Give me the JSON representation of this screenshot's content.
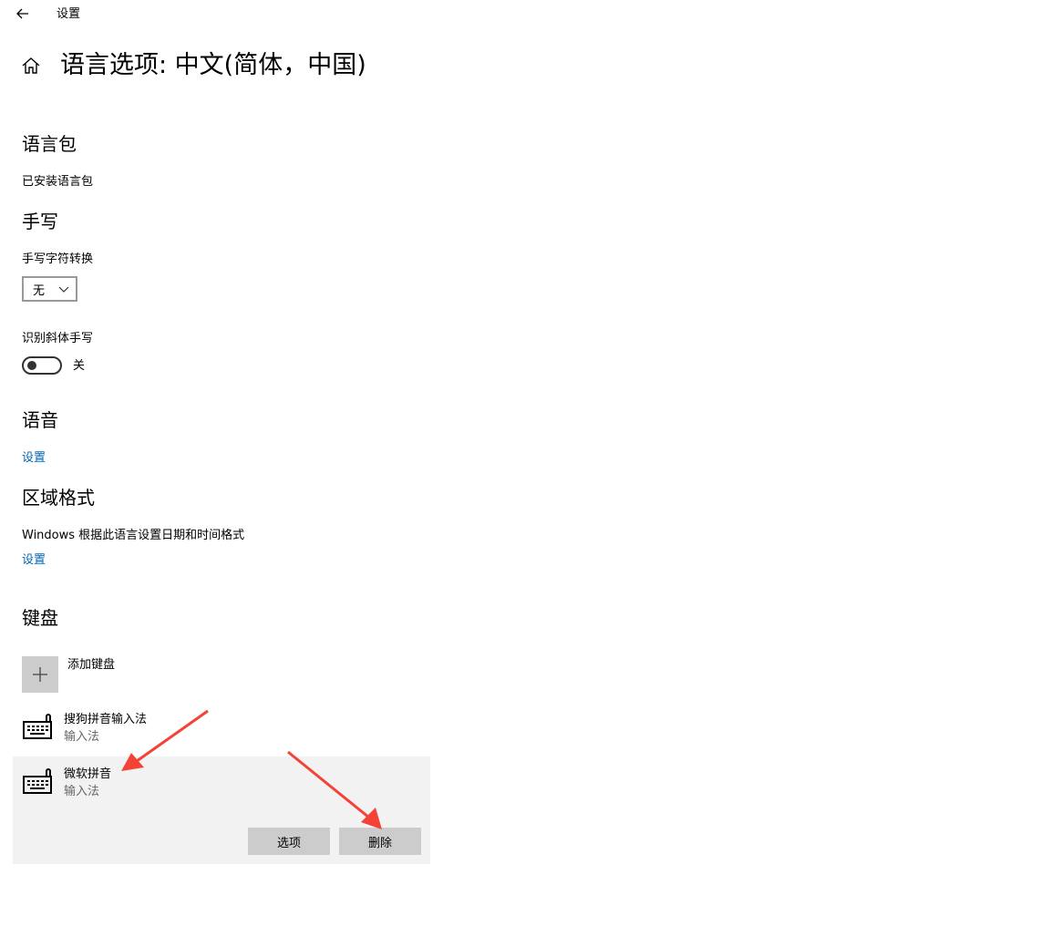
{
  "topbar": {
    "back_icon": "back-arrow-icon",
    "title": "设置"
  },
  "header": {
    "home_icon": "home-icon",
    "title": "语言选项: 中文(简体，中国)"
  },
  "language_pack": {
    "heading": "语言包",
    "status": "已安装语言包"
  },
  "handwriting": {
    "heading": "手写",
    "conversion_label": "手写字符转换",
    "conversion_value": "无",
    "italic_label": "识别斜体手写",
    "italic_state": "关",
    "italic_on": false
  },
  "speech": {
    "heading": "语音",
    "settings_link": "设置"
  },
  "regional": {
    "heading": "区域格式",
    "description": "Windows 根据此语言设置日期和时间格式",
    "settings_link": "设置"
  },
  "keyboard": {
    "heading": "键盘",
    "add_label": "添加键盘",
    "items": [
      {
        "name": "搜狗拼音输入法",
        "type": "输入法",
        "icon": "keyboard-icon"
      },
      {
        "name": "微软拼音",
        "type": "输入法",
        "icon": "keyboard-icon"
      }
    ],
    "options_button": "选项",
    "remove_button": "删除"
  },
  "colors": {
    "accent": "#0067b8",
    "annotation": "#f44336",
    "selected_bg": "#f2f2f2",
    "button_bg": "#cccccc"
  }
}
